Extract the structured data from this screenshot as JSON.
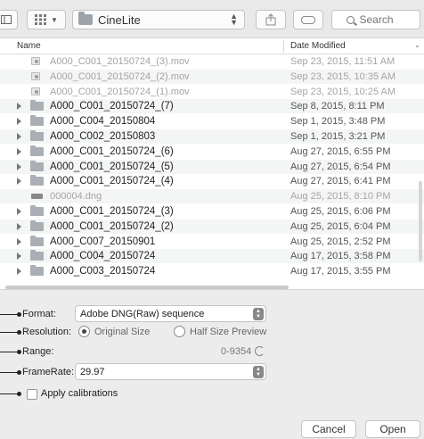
{
  "toolbar": {
    "location": "CineLite",
    "search_placeholder": "Search"
  },
  "browser": {
    "columns": {
      "name": "Name",
      "date_modified": "Date Modified"
    },
    "rows": [
      {
        "kind": "mov",
        "name": "A000_C001_20150724_(3).mov",
        "date": "Sep 23, 2015, 11:51 AM",
        "dim": true
      },
      {
        "kind": "mov",
        "name": "A000_C001_20150724_(2).mov",
        "date": "Sep 23, 2015, 10:35 AM",
        "dim": true
      },
      {
        "kind": "mov",
        "name": "A000_C001_20150724_(1).mov",
        "date": "Sep 23, 2015, 10:25 AM",
        "dim": true
      },
      {
        "kind": "folder",
        "name": "A000_C001_20150724_(7)",
        "date": "Sep 8, 2015, 8:11 PM",
        "dim": false
      },
      {
        "kind": "folder",
        "name": "A000_C004_20150804",
        "date": "Sep 1, 2015, 3:48 PM",
        "dim": false
      },
      {
        "kind": "folder",
        "name": "A000_C002_20150803",
        "date": "Sep 1, 2015, 3:21 PM",
        "dim": false
      },
      {
        "kind": "folder",
        "name": "A000_C001_20150724_(6)",
        "date": "Aug 27, 2015, 6:55 PM",
        "dim": false
      },
      {
        "kind": "folder",
        "name": "A000_C001_20150724_(5)",
        "date": "Aug 27, 2015, 6:54 PM",
        "dim": false
      },
      {
        "kind": "folder",
        "name": "A000_C001_20150724_(4)",
        "date": "Aug 27, 2015, 6:41 PM",
        "dim": false
      },
      {
        "kind": "dng",
        "name": "000004.dng",
        "date": "Aug 25, 2015, 8:10 PM",
        "dim": true
      },
      {
        "kind": "folder",
        "name": "A000_C001_20150724_(3)",
        "date": "Aug 25, 2015, 6:06 PM",
        "dim": false
      },
      {
        "kind": "folder",
        "name": "A000_C001_20150724_(2)",
        "date": "Aug 25, 2015, 6:04 PM",
        "dim": false
      },
      {
        "kind": "folder",
        "name": "A000_C007_20150901",
        "date": "Aug 25, 2015, 2:52 PM",
        "dim": false
      },
      {
        "kind": "folder",
        "name": "A000_C004_20150724",
        "date": "Aug 17, 2015, 3:58 PM",
        "dim": false
      },
      {
        "kind": "folder",
        "name": "A000_C003_20150724",
        "date": "Aug 17, 2015, 3:55 PM",
        "dim": false
      }
    ]
  },
  "options": {
    "format_label": "Format:",
    "format_value": "Adobe DNG(Raw) sequence",
    "resolution_label": "Resolution:",
    "resolution_original": "Original Size",
    "resolution_half": "Half Size Preview",
    "resolution_selected": "Original Size",
    "range_label": "Range:",
    "range_value": "0-9354",
    "framerate_label": "FrameRate:",
    "framerate_value": "29.97",
    "apply_calibrations_label": "Apply calibrations",
    "apply_calibrations_checked": false
  },
  "footer": {
    "cancel_label": "Cancel",
    "open_label": "Open"
  }
}
